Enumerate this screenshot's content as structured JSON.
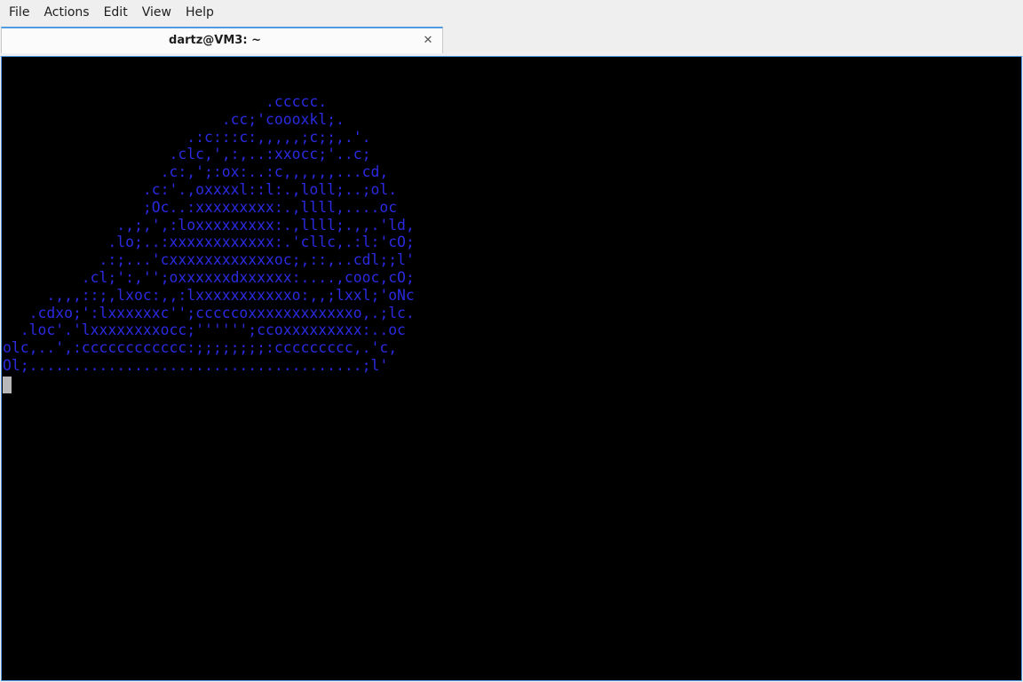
{
  "menubar": {
    "items": [
      "File",
      "Actions",
      "Edit",
      "View",
      "Help"
    ]
  },
  "tab": {
    "title": "dartz@VM3: ~",
    "close_glyph": "✕"
  },
  "terminal": {
    "text_color": "#2a2ae0",
    "background": "#000000",
    "lines": [
      "                              .ccccc.",
      "                         .cc;'coooxkl;.",
      "                     .:c:::c:,,,,,;c;;,.'.",
      "                   .clc,',:,..:xxocc;'..c;",
      "                  .c:,';:ox:..:c,,,,,,...cd,",
      "                .c:'.,oxxxxl::l:.,loll;..;ol.",
      "                ;Oc..:xxxxxxxxx:.,llll,....oc",
      "             .,;,',:loxxxxxxxxx:.,llll;.,,.'ld,",
      "            .lo;..:xxxxxxxxxxxx:.'cllc,.:l:'cO;",
      "           .:;...'cxxxxxxxxxxxxoc;,::,..cdl;;l'",
      "         .cl;':,'';oxxxxxxdxxxxxx:....,cooc,cO;",
      "     .,,,::;,lxoc:,,:lxxxxxxxxxxxo:,,;lxxl;'oNc",
      "   .cdxo;':lxxxxxxc'';cccccoxxxxxxxxxxxxo,.;lc.",
      "  .loc'.'lxxxxxxxxocc;'''''';ccoxxxxxxxxx:..oc",
      "olc,..',:cccccccccccc:;;;;;;;;:ccccccccc,.'c,",
      "Ol;......................................;l'"
    ]
  }
}
